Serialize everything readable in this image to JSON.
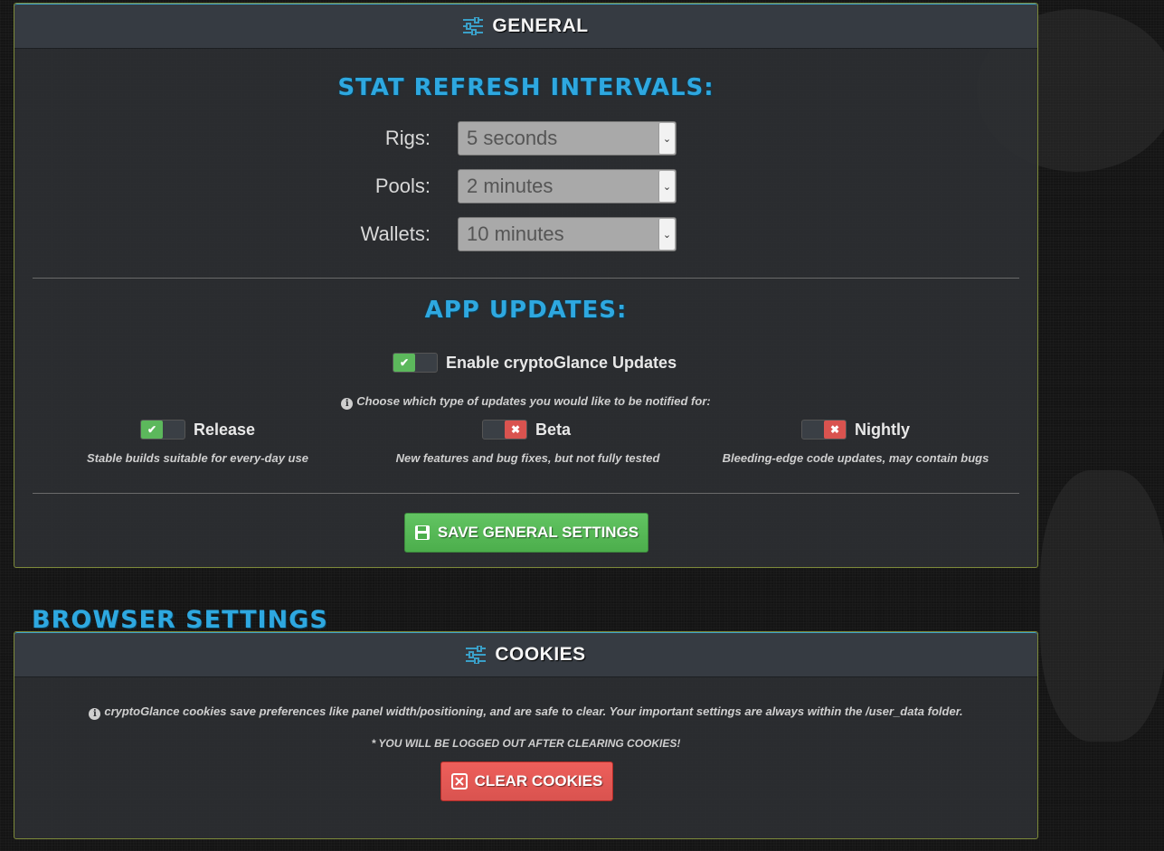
{
  "general_panel": {
    "title": "GENERAL",
    "refresh_title": "STAT REFRESH INTERVALS:",
    "intervals": [
      {
        "label": "Rigs:",
        "value": "5 seconds"
      },
      {
        "label": "Pools:",
        "value": "2 minutes"
      },
      {
        "label": "Wallets:",
        "value": "10 minutes"
      }
    ],
    "updates_title": "APP UPDATES:",
    "enable_updates": {
      "label": "Enable cryptoGlance Updates",
      "on": true
    },
    "choose_hint": "Choose which type of updates you would like to be notified for:",
    "update_types": [
      {
        "label": "Release",
        "on": true,
        "desc": "Stable builds suitable for every-day use"
      },
      {
        "label": "Beta",
        "on": false,
        "desc": "New features and bug fixes, but not fully tested"
      },
      {
        "label": "Nightly",
        "on": false,
        "desc": "Bleeding-edge code updates, may contain bugs"
      }
    ],
    "save_button": "SAVE GENERAL SETTINGS"
  },
  "browser_settings": {
    "heading": "BROWSER SETTINGS",
    "cookies_panel": {
      "title": "COOKIES",
      "info": "cryptoGlance cookies save preferences like panel width/positioning, and are safe to clear. Your important settings are always within the /user_data folder.",
      "warning": "* YOU WILL BE LOGGED OUT AFTER CLEARING COOKIES!",
      "clear_button": "CLEAR COOKIES"
    }
  },
  "colors": {
    "accent_blue": "#2ea8e0",
    "toggle_on": "#5cb85c",
    "toggle_off": "#d9534f"
  }
}
